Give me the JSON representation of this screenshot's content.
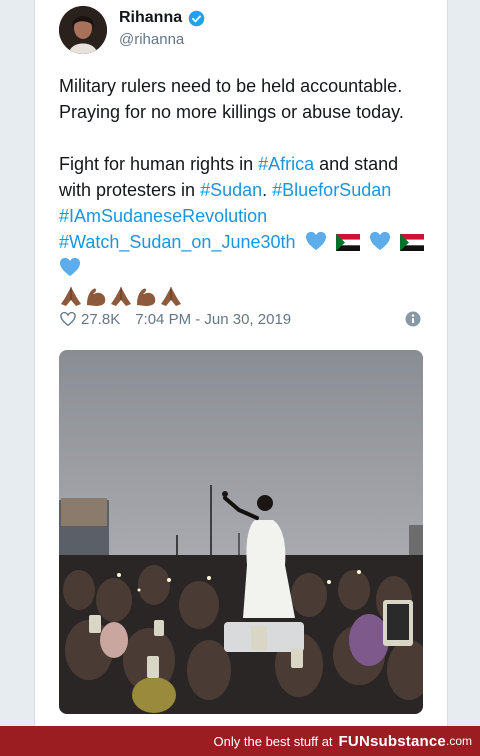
{
  "tweet": {
    "author": {
      "name": "Rihanna",
      "handle": "@rihanna",
      "verified": true
    },
    "line1": "Military rulers need to be held accountable.",
    "line2": "Praying for no more killings or abuse today.",
    "line3a": "Fight for human rights in ",
    "tag_africa": "#Africa",
    "line3b": " and stand",
    "line4a": "with protesters in ",
    "tag_sudan": "#Sudan",
    "line4b": ". ",
    "tag_blue": "#BlueforSudan",
    "tag_iam": "#IAmSudaneseRevolution",
    "tag_watch": "#Watch_Sudan_on_June30th",
    "emojis_inline": [
      "blue-heart",
      "sudan-flag",
      "blue-heart",
      "sudan-flag",
      "blue-heart"
    ],
    "emojis_row": [
      "praying-hands",
      "flexed-biceps",
      "praying-hands",
      "flexed-biceps",
      "praying-hands"
    ],
    "likes": "27.8K",
    "timestamp": "7:04 PM - Jun 30, 2019"
  },
  "footer": {
    "tagline": "Only the best stuff at",
    "brand": "FUNsubstance",
    "domain": ".com"
  },
  "colors": {
    "link": "#1b95e0",
    "verified": "#1da1f2",
    "footer_bg": "#9b1d22",
    "page_bg": "#e6ecf0"
  }
}
